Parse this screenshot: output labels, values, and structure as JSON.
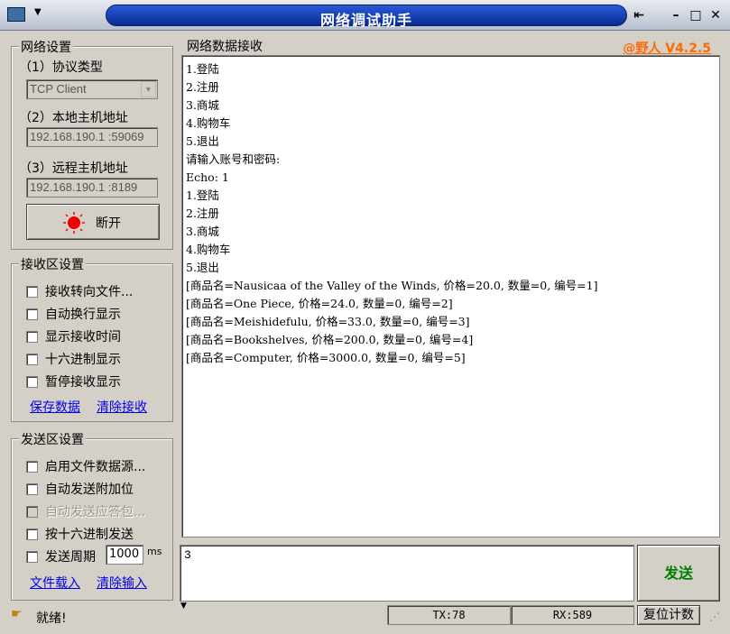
{
  "window": {
    "title": "网络调试助手",
    "version": "@野人 V4.2.5"
  },
  "network_settings": {
    "group_title": "网络设置",
    "protocol_label": "（1）协议类型",
    "protocol_value": "TCP Client",
    "local_label": "（2）本地主机地址",
    "local_value": "192.168.190.1 :59069",
    "remote_label": "（3）远程主机地址",
    "remote_value": "192.168.190.1 :8189",
    "connect_button": "断开"
  },
  "receive_settings": {
    "group_title": "接收区设置",
    "options": [
      "接收转向文件...",
      "自动换行显示",
      "显示接收时间",
      "十六进制显示",
      "暂停接收显示"
    ],
    "save_link": "保存数据",
    "clear_link": "清除接收"
  },
  "send_settings": {
    "group_title": "发送区设置",
    "options": [
      "启用文件数据源...",
      "自动发送附加位",
      "自动发送应答包...",
      "按十六进制发送",
      "发送周期"
    ],
    "period_value": "1000",
    "period_unit": "ms",
    "load_link": "文件载入",
    "clear_link": "清除输入"
  },
  "receive_area": {
    "title": "网络数据接收",
    "lines": [
      "1.登陆",
      "2.注册",
      "3.商城",
      "4.购物车",
      "5.退出",
      "请输入账号和密码:",
      "Echo: 1",
      "1.登陆",
      "2.注册",
      "3.商城",
      "4.购物车",
      "5.退出",
      "[商品名=Nausicaa of the Valley of the Winds, 价格=20.0, 数量=0, 编号=1]",
      "[商品名=One Piece, 价格=24.0, 数量=0, 编号=2]",
      "[商品名=Meishidefulu, 价格=33.0, 数量=0, 编号=3]",
      "[商品名=Bookshelves, 价格=200.0, 数量=0, 编号=4]",
      "[商品名=Computer, 价格=3000.0, 数量=0, 编号=5]"
    ]
  },
  "send_area": {
    "value": "3",
    "send_button": "发送"
  },
  "status": {
    "ready": "就绪!",
    "tx": "TX:78",
    "rx": "RX:589",
    "reset_button": "复位计数"
  },
  "colors": {
    "title_bar": "#0a2b95",
    "version": "#ff6a00",
    "send_button_text": "#008000",
    "link": "#0000ee"
  }
}
